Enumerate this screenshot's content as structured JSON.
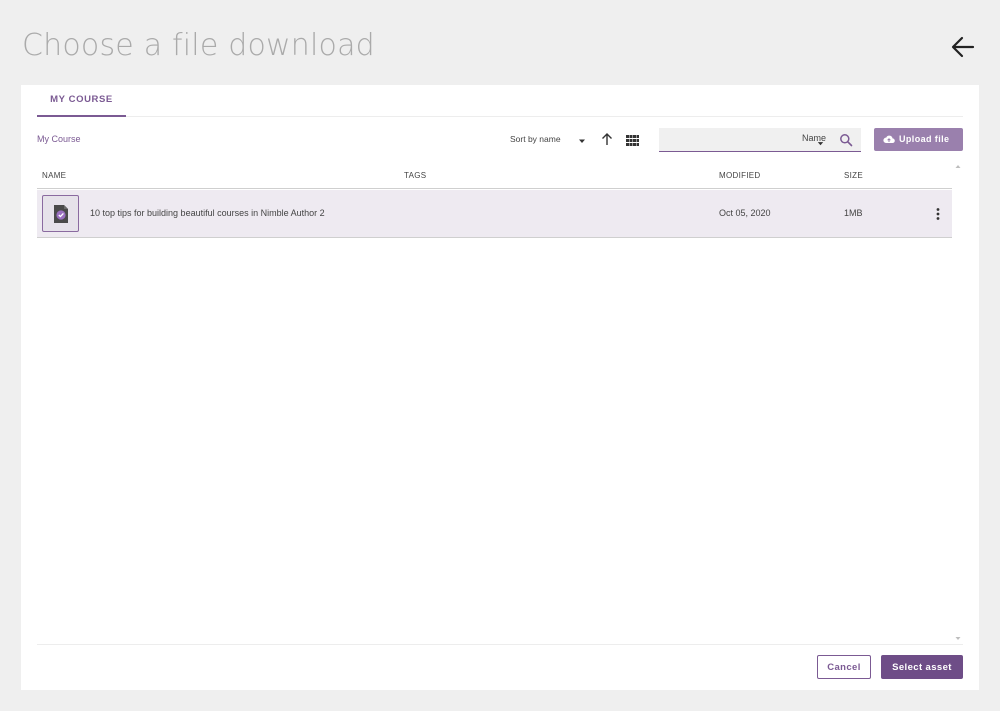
{
  "dialog": {
    "title": "Choose a file download"
  },
  "tabs": [
    {
      "label": "MY COURSE",
      "active": true
    }
  ],
  "breadcrumb": "My Course",
  "toolbar": {
    "sort_label": "Sort by name",
    "search_value": "",
    "search_field": "Name",
    "upload_label": "Upload file"
  },
  "table": {
    "columns": {
      "name": "NAME",
      "tags": "TAGS",
      "modified": "MODIFIED",
      "size": "SIZE"
    },
    "rows": [
      {
        "name": "10 top tips for building beautiful courses in Nimble Author 2",
        "tags": "",
        "modified": "Oct 05, 2020",
        "size": "1MB"
      }
    ]
  },
  "footer": {
    "cancel_label": "Cancel",
    "select_label": "Select asset"
  },
  "colors": {
    "accent": "#7b5a93",
    "accent_light": "#9a80ad",
    "primary_button": "#6e4d87",
    "row_selected": "#eeeaf1",
    "page_bg": "#efefef"
  },
  "icons": {
    "back": "arrow-left-icon",
    "sort": "caret-down-icon",
    "direction": "arrow-up-icon",
    "view": "grid-view-icon",
    "search": "magnifier-icon",
    "upload": "cloud-upload-icon",
    "file": "file-check-icon",
    "more": "vertical-dots-icon"
  }
}
